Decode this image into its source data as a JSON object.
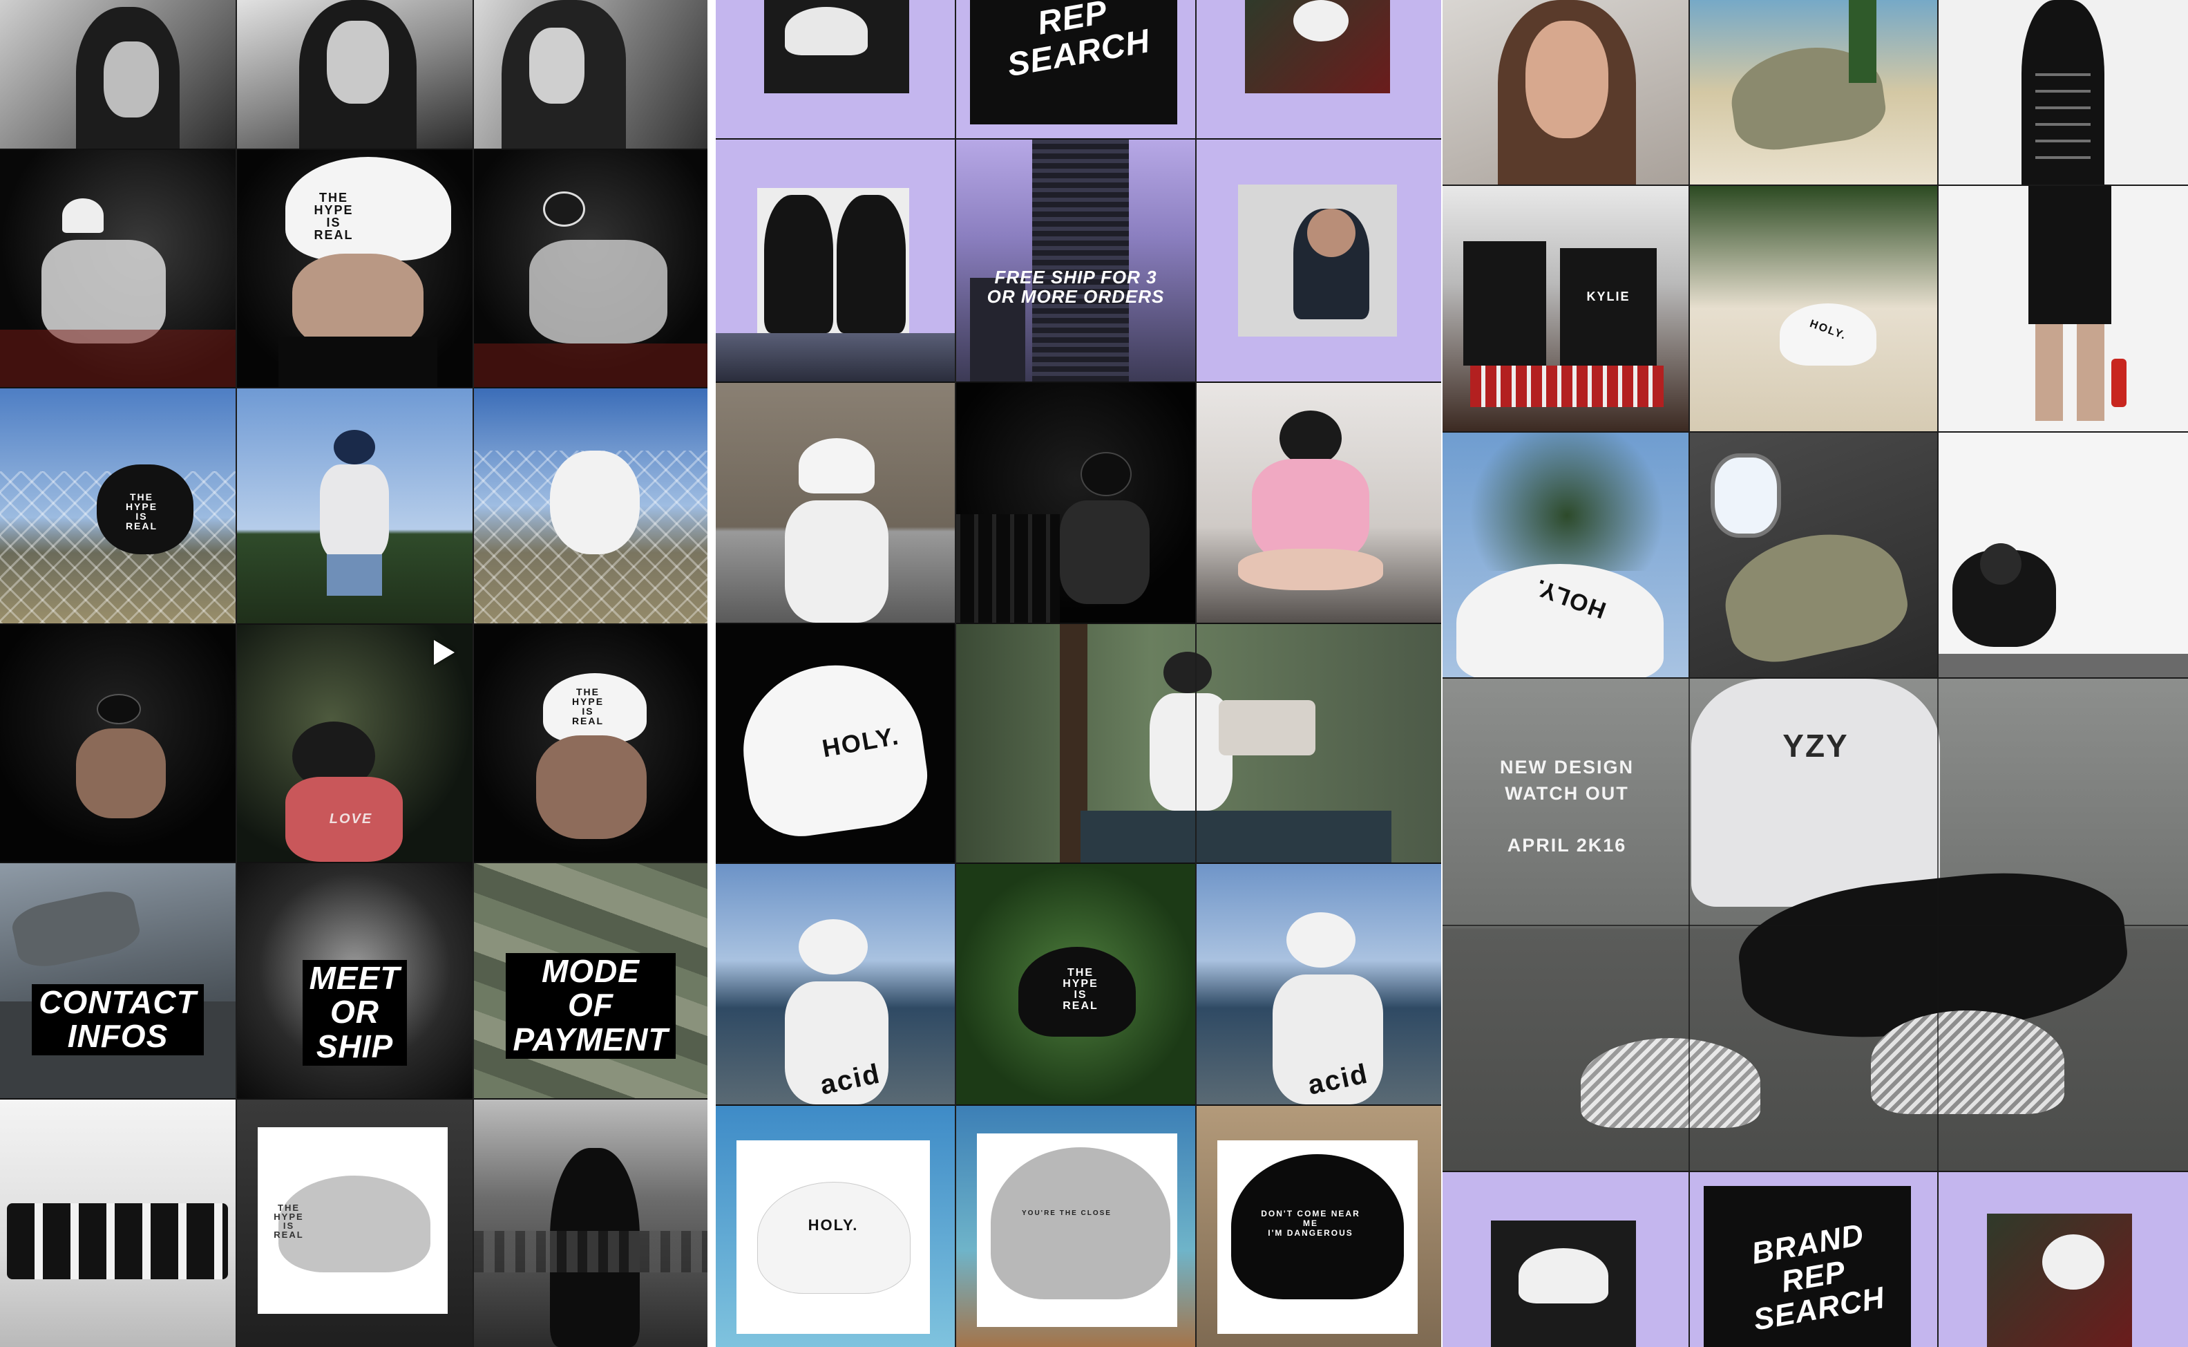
{
  "collage": {
    "columns": [
      {
        "tiles": [
          {
            "caption": ""
          },
          {
            "caption": ""
          },
          {
            "caption": ""
          },
          {
            "caption": ""
          },
          {
            "caption": ""
          },
          {
            "caption": ""
          },
          {
            "caption": ""
          },
          {
            "caption": ""
          },
          {
            "caption": ""
          },
          {
            "caption": ""
          },
          {
            "caption": ""
          },
          {
            "caption": ""
          },
          {
            "caption": "CONTACT\nINFOS"
          },
          {
            "caption": "MEET\nOR\nSHIP"
          },
          {
            "caption": "MODE\nOF\nPAYMENT"
          },
          {
            "caption": ""
          },
          {
            "caption": ""
          },
          {
            "caption": ""
          }
        ]
      },
      {
        "tiles": [
          {
            "caption": ""
          },
          {
            "caption": "REP\nSEARCH"
          },
          {
            "caption": ""
          },
          {
            "caption": ""
          },
          {
            "caption": "FREE SHIP FOR 3\nOR MORE ORDERS"
          },
          {
            "caption": ""
          },
          {
            "caption": ""
          },
          {
            "caption": ""
          },
          {
            "caption": ""
          },
          {
            "caption": "HOLY."
          },
          {
            "caption": ""
          },
          {
            "caption": ""
          },
          {
            "caption": ""
          },
          {
            "caption": ""
          },
          {
            "caption": ""
          },
          {
            "caption": "HOLY."
          },
          {
            "caption": "YOU'RE THE CLOSE"
          },
          {
            "caption": "DON'T COME NEAR ME\nI'M DANGEROUS"
          }
        ]
      },
      {
        "tiles": [
          {
            "caption": ""
          },
          {
            "caption": ""
          },
          {
            "caption": ""
          },
          {
            "caption": ""
          },
          {
            "caption": "KYLIE"
          },
          {
            "caption": ""
          },
          {
            "caption": "HOLY."
          },
          {
            "caption": ""
          },
          {
            "caption": ""
          },
          {
            "caption": "NEW DESIGN\nWATCH OUT\n\nAPRIL 2K16"
          },
          {
            "caption": "YZY"
          },
          {
            "caption": ""
          },
          {
            "caption": ""
          },
          {
            "caption": ""
          },
          {
            "caption": ""
          },
          {
            "caption": ""
          },
          {
            "caption": "BRAND\nREP\nSEARCH"
          },
          {
            "caption": ""
          }
        ]
      }
    ],
    "cap_prints": [
      "THE\nHYPE\nIS\nREAL",
      "HOLY.",
      "acid",
      "LOVE"
    ],
    "colors": {
      "lavender": "#c4b6ee",
      "dark": "#141414",
      "sky": "#5d86c2",
      "pink": "#e8a5c0",
      "olive": "#8b8a6e",
      "red_bottle": "#c8261f"
    },
    "icons": [
      "play-icon"
    ]
  }
}
